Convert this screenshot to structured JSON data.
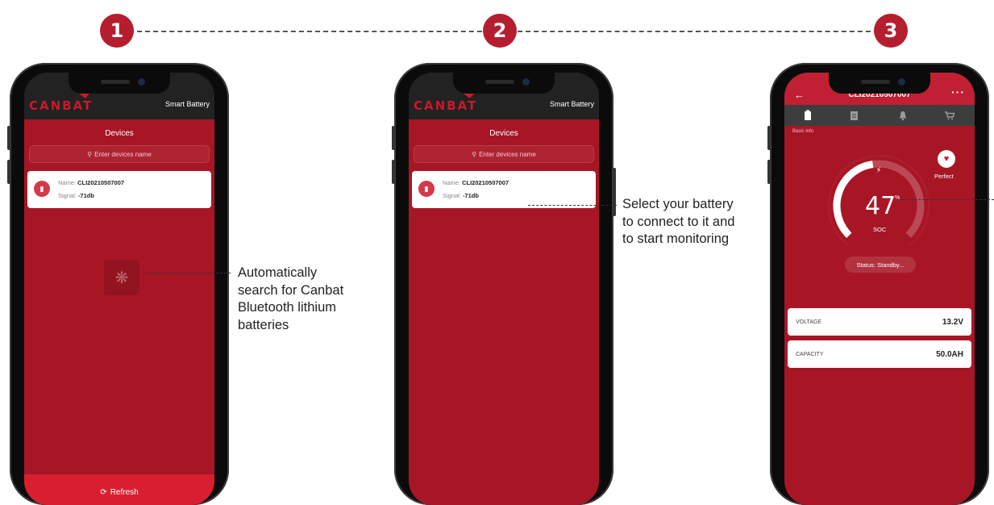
{
  "steps": [
    "1",
    "2",
    "3"
  ],
  "app": {
    "logo": "CANBAT",
    "header_right": "Smart Battery",
    "devices_title": "Devices",
    "search_placeholder": "Enter devices name",
    "device": {
      "name_label": "Name:",
      "name_value": "CLI20210507007",
      "signal_label": "Signal:",
      "signal_value": "-71db"
    },
    "refresh_label": "Refresh"
  },
  "annotations": {
    "step1": [
      "Automatically",
      "search for Canbat",
      "Bluetooth lithium",
      "batteries"
    ],
    "step2": [
      "Select your battery",
      "to connect to it and",
      "to start monitoring"
    ]
  },
  "detail": {
    "title": "CLI20210507007",
    "tab_basic": "Basic info",
    "health": "Perfect",
    "soc_value": "47",
    "soc_unit": "%",
    "soc_label": "SOC",
    "soc_fraction": 0.47,
    "status": "Status: Standby...",
    "voltage_label": "VOLTAGE",
    "voltage_value": "13.2V",
    "capacity_label": "CAPACITY",
    "capacity_value": "50.0AH"
  },
  "colors": {
    "brand_red": "#b51e2e",
    "screen_red": "#a81626",
    "header_dark": "#222222"
  }
}
